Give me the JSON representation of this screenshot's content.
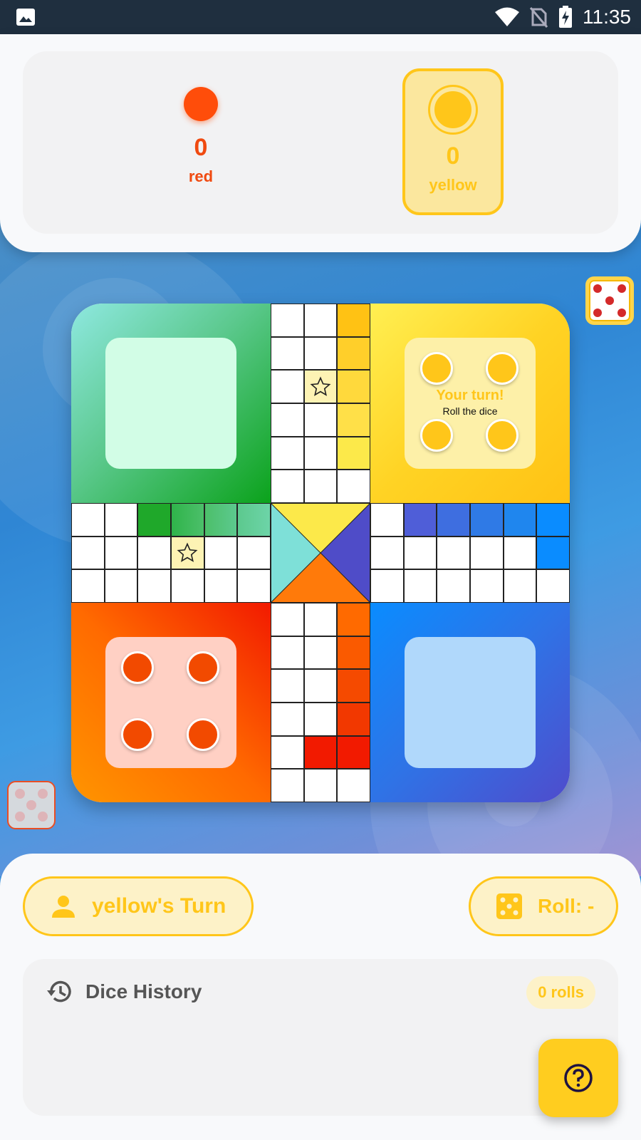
{
  "status_bar": {
    "time": "11:35",
    "icons": [
      "image-icon",
      "wifi-icon",
      "no-sim-icon",
      "battery-charging-icon"
    ]
  },
  "scores": {
    "red": {
      "count": "0",
      "name": "red",
      "color": "#ff4d0a"
    },
    "yellow": {
      "count": "0",
      "name": "yellow",
      "color": "#ffc61a",
      "active": true
    }
  },
  "board": {
    "yellow_home": {
      "title": "Your turn!",
      "subtitle": "Roll the dice",
      "tokens": 4
    },
    "red_home": {
      "tokens": 4
    },
    "colors": {
      "green": "#0ba21b",
      "yellow": "#ffc61a",
      "red": "#f24a00",
      "blue": "#0a8cff"
    }
  },
  "dice": {
    "top_value": 5,
    "left_value": 5
  },
  "turn": {
    "label": "yellow's Turn",
    "icon": "person-icon"
  },
  "roll": {
    "label": "Roll: -",
    "icon": "dice-icon"
  },
  "history": {
    "title": "Dice History",
    "count_label": "0 rolls",
    "icon": "history-icon"
  },
  "help": {
    "icon": "help-icon"
  }
}
